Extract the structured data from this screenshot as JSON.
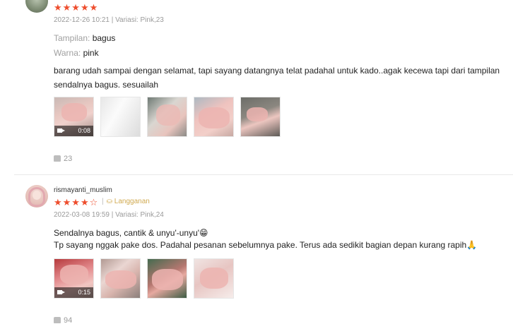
{
  "reviews": [
    {
      "username": "",
      "stars": {
        "filled": "★★★★★",
        "empty": ""
      },
      "meta": "2022-12-26 10:21 | Variasi: Pink,23",
      "badge": "",
      "attributes": [
        {
          "key": "Tampilan:",
          "value": "bagus"
        },
        {
          "key": "Warna:",
          "value": "pink"
        }
      ],
      "text": "barang udah sampai dengan selamat, tapi sayang datangnya telat padahal untuk kado..agak kecewa tapi dari tampilan sendalnya bagus. sesuailah",
      "media": [
        {
          "type": "video",
          "duration": "0:08"
        },
        {
          "type": "image"
        },
        {
          "type": "image"
        },
        {
          "type": "image"
        },
        {
          "type": "image"
        }
      ],
      "likes": "23"
    },
    {
      "username": "rismayanti_muslim",
      "stars": {
        "filled": "★★★★",
        "empty": "☆"
      },
      "meta": "2022-03-08 19:59 | Variasi: Pink,24",
      "badge": "Langganan",
      "attributes": [],
      "text_line1": "Sendalnya bagus, cantik & unyu'-unyu'😁",
      "text_line2": "Tp sayang nggak pake dos. Padahal pesanan sebelumnya pake. Terus ada sedikit bagian depan kurang rapih🙏",
      "media": [
        {
          "type": "video",
          "duration": "0:15"
        },
        {
          "type": "image"
        },
        {
          "type": "image"
        },
        {
          "type": "image"
        }
      ],
      "likes": "94"
    }
  ],
  "colors": {
    "accent": "#ee4d2d",
    "badge": "#d0a94f",
    "muted": "#9a9a9a"
  }
}
